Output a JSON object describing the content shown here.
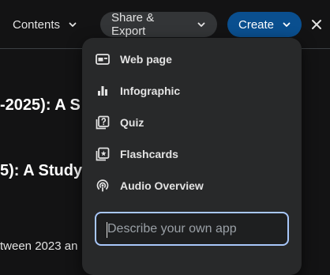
{
  "toolbar": {
    "contents_label": "Contents",
    "share_label": "Share & Export",
    "create_label": "Create"
  },
  "document": {
    "heading_1": "-2025): A S",
    "heading_2": "5): A Study",
    "paragraph": "tween 2023 an"
  },
  "create_menu": {
    "items": [
      {
        "label": "Web page",
        "icon": "web-page-icon"
      },
      {
        "label": "Infographic",
        "icon": "bar-chart-icon"
      },
      {
        "label": "Quiz",
        "icon": "quiz-icon"
      },
      {
        "label": "Flashcards",
        "icon": "flashcards-icon"
      },
      {
        "label": "Audio Overview",
        "icon": "podcast-icon"
      }
    ],
    "input_placeholder": "Describe your own app"
  },
  "colors": {
    "background": "#131314",
    "menu": "#28292a",
    "create_button": "#0a4f8f",
    "focus_border": "#a8c7fa"
  }
}
